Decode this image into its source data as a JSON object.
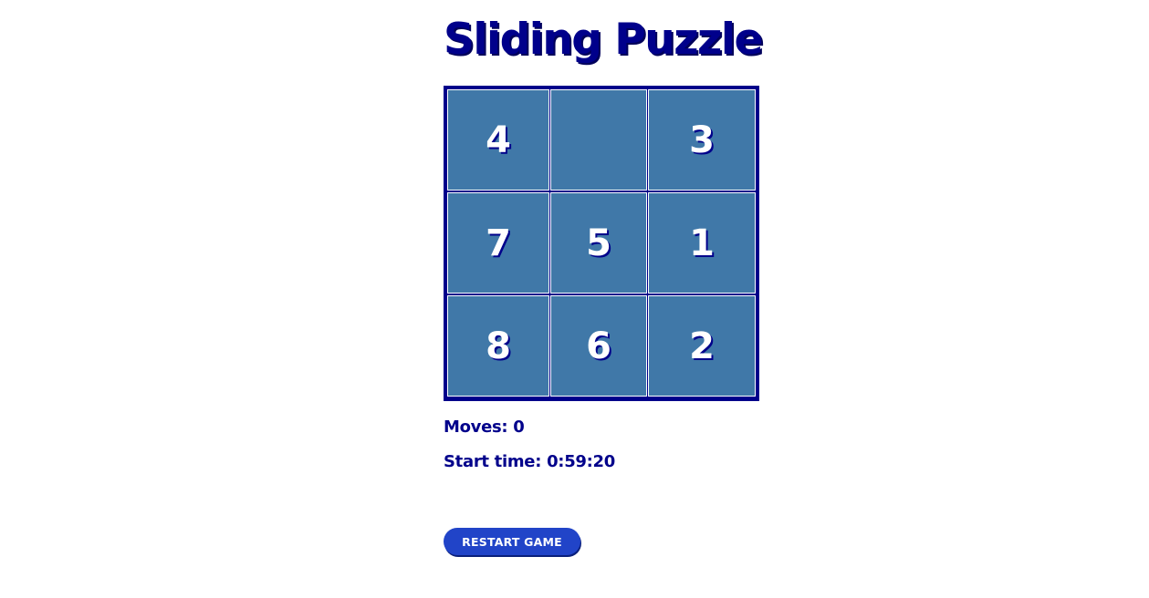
{
  "title": "Sliding Puzzle",
  "board": {
    "rows": 3,
    "cols": 3,
    "tiles": [
      "4",
      "",
      "3",
      "7",
      "5",
      "1",
      "8",
      "6",
      "2"
    ]
  },
  "stats": {
    "moves_label": "Moves: 0",
    "start_time_label": "Start time: 0:59:20"
  },
  "restart_label": "RESTART GAME",
  "colors": {
    "accent": "#00008b",
    "tile": "#4078a8",
    "button": "#2144c8"
  }
}
